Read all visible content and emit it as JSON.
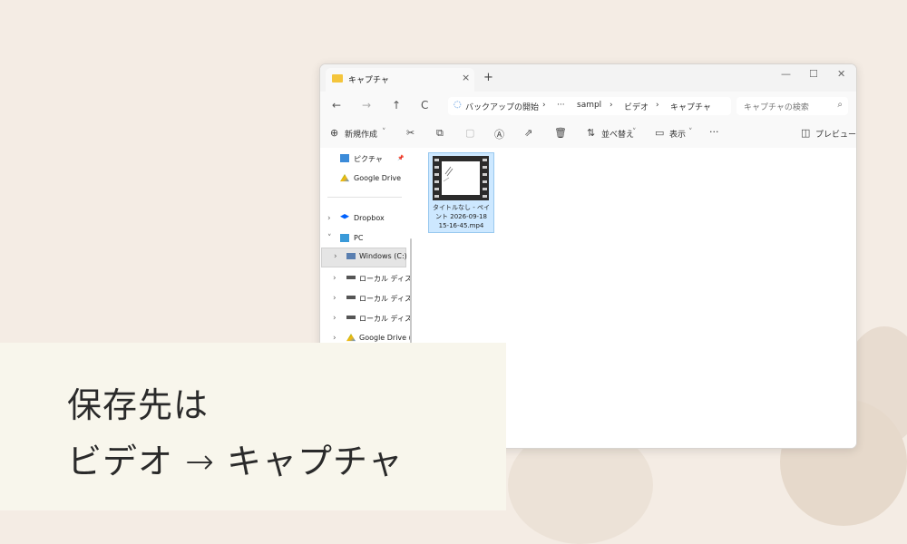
{
  "window": {
    "tab_title": "キャプチャ",
    "tab_close": "×",
    "new_tab": "+",
    "controls": {
      "minimize": "—",
      "maximize": "☐",
      "close": "✕"
    }
  },
  "address": {
    "back": "←",
    "forward": "→",
    "up": "↑",
    "refresh": "C",
    "crumbs": [
      "バックアップの開始",
      "›",
      "···",
      "sampl",
      "›",
      "ビデオ",
      "›",
      "キャプチャ"
    ],
    "search_placeholder": "キャプチャの検索",
    "search_icon": "search-icon"
  },
  "toolbar": {
    "new_label": "新規作成",
    "sort_label": "並べ替え",
    "view_label": "表示",
    "more": "···",
    "preview_label": "プレビュー"
  },
  "sidebar": {
    "items": [
      {
        "label": "ピクチャ",
        "pin": "📌"
      },
      {
        "label": "Google Drive",
        "pin": "📌"
      },
      {
        "label": "Dropbox"
      },
      {
        "label": "PC"
      },
      {
        "label": "Windows (C:)"
      },
      {
        "label": "ローカル ディスク"
      },
      {
        "label": "ローカル ディスク"
      },
      {
        "label": "ローカル ディスク"
      },
      {
        "label": "Google Drive ("
      }
    ]
  },
  "file": {
    "name_line1": "タイトルなし - ペイ",
    "name_line2": "ント 2026-09-18",
    "name_line3": "15-16-45.mp4"
  },
  "caption": {
    "line1": "保存先は",
    "line2": "ビデオ → キャプチャ"
  },
  "colors": {
    "background": "#f4ece4",
    "caption_bg": "#f8f6ec",
    "selection": "#cde8ff",
    "folder": "#f4c53c"
  }
}
